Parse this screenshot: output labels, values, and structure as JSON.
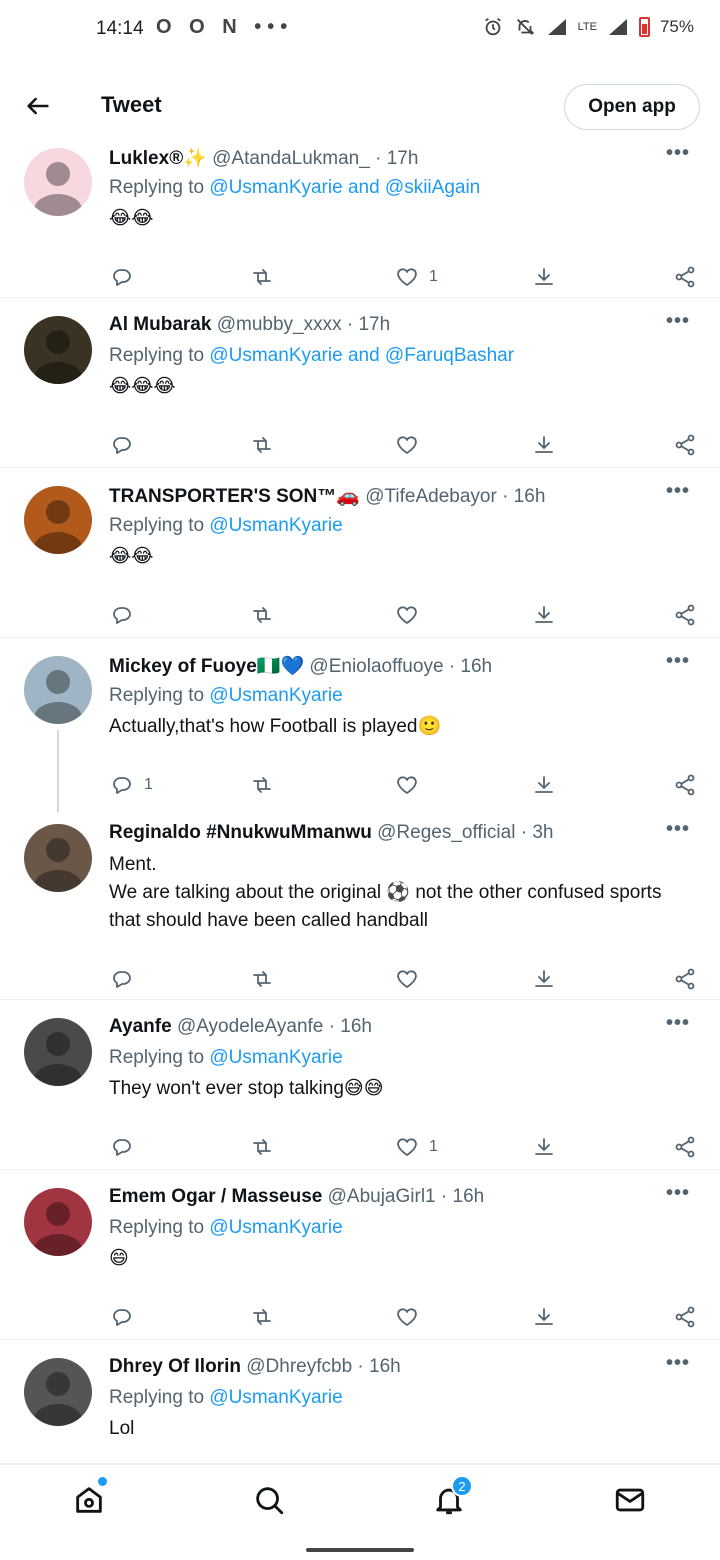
{
  "status_bar": {
    "time": "14:14",
    "left_icons": "O O N •••",
    "network": "LTE",
    "battery": "75%"
  },
  "header": {
    "title": "Tweet",
    "open_app": "Open app"
  },
  "tweets": [
    {
      "name": "Luklex®✨",
      "handle": "@AtandaLukman_",
      "time": "· 17h",
      "replying_prefix": "Replying to ",
      "replying_to": "@UsmanKyarie and @skiiAgain",
      "text": "😂😂",
      "likes": "1",
      "replies": "",
      "avatar_color": "#f6d8de"
    },
    {
      "name": "Al Mubarak",
      "handle": "@mubby_xxxx",
      "time": "· 17h",
      "replying_prefix": "Replying to ",
      "replying_to": "@UsmanKyarie and @FaruqBashar",
      "text": "😂😂😂",
      "likes": "",
      "replies": "",
      "avatar_color": "#3a3222"
    },
    {
      "name": "TRANSPORTER'S SON™🚗",
      "handle": "@TifeAdebayor",
      "time": "· 16h",
      "replying_prefix": "Replying to ",
      "replying_to": "@UsmanKyarie",
      "text": "😂😂",
      "likes": "",
      "replies": "",
      "avatar_color": "#b15a1c"
    },
    {
      "name": "Mickey of Fuoye🇳🇬💙",
      "handle": "@Eniolaoffuoye",
      "time": "· 16h",
      "replying_prefix": "Replying to ",
      "replying_to": "@UsmanKyarie",
      "text": "Actually,that's how Football is played🙂",
      "likes": "",
      "replies": "1",
      "avatar_color": "#9fb4c4"
    },
    {
      "name": "Reginaldo #NnukwuMmanwu",
      "handle": "@Reges_official",
      "time": "· 3h",
      "replying_prefix": "",
      "replying_to": "",
      "text": "Ment.\nWe are talking about the original ⚽ not the other confused sports that should have been called handball",
      "likes": "",
      "replies": "",
      "avatar_color": "#6b5748"
    },
    {
      "name": "Ayanfe",
      "handle": "@AyodeleAyanfe",
      "time": "· 16h",
      "replying_prefix": "Replying to ",
      "replying_to": "@UsmanKyarie",
      "text": "They won't ever stop talking😅😅",
      "likes": "1",
      "replies": "",
      "avatar_color": "#4a4a4a"
    },
    {
      "name": "Emem Ogar / Masseuse",
      "handle": "@AbujaGirl1",
      "time": "· 16h",
      "replying_prefix": "Replying to ",
      "replying_to": "@UsmanKyarie",
      "text": "😄",
      "likes": "",
      "replies": "",
      "avatar_color": "#a03440"
    },
    {
      "name": "Dhrey Of Ilorin",
      "handle": "@Dhreyfcbb",
      "time": "· 16h",
      "replying_prefix": "Replying to ",
      "replying_to": "@UsmanKyarie",
      "text": "Lol",
      "likes": "",
      "replies": "",
      "avatar_color": "#555555"
    }
  ],
  "icons": {
    "reply": "reply-icon",
    "retweet": "retweet-icon",
    "like": "heart-icon",
    "download": "download-icon",
    "share": "share-icon",
    "more": "more-icon"
  },
  "bottom_nav": {
    "notifications_badge": "2"
  },
  "colors": {
    "accent": "#1d9bf0",
    "secondary_text": "#536471",
    "divider": "#eff3f4"
  }
}
